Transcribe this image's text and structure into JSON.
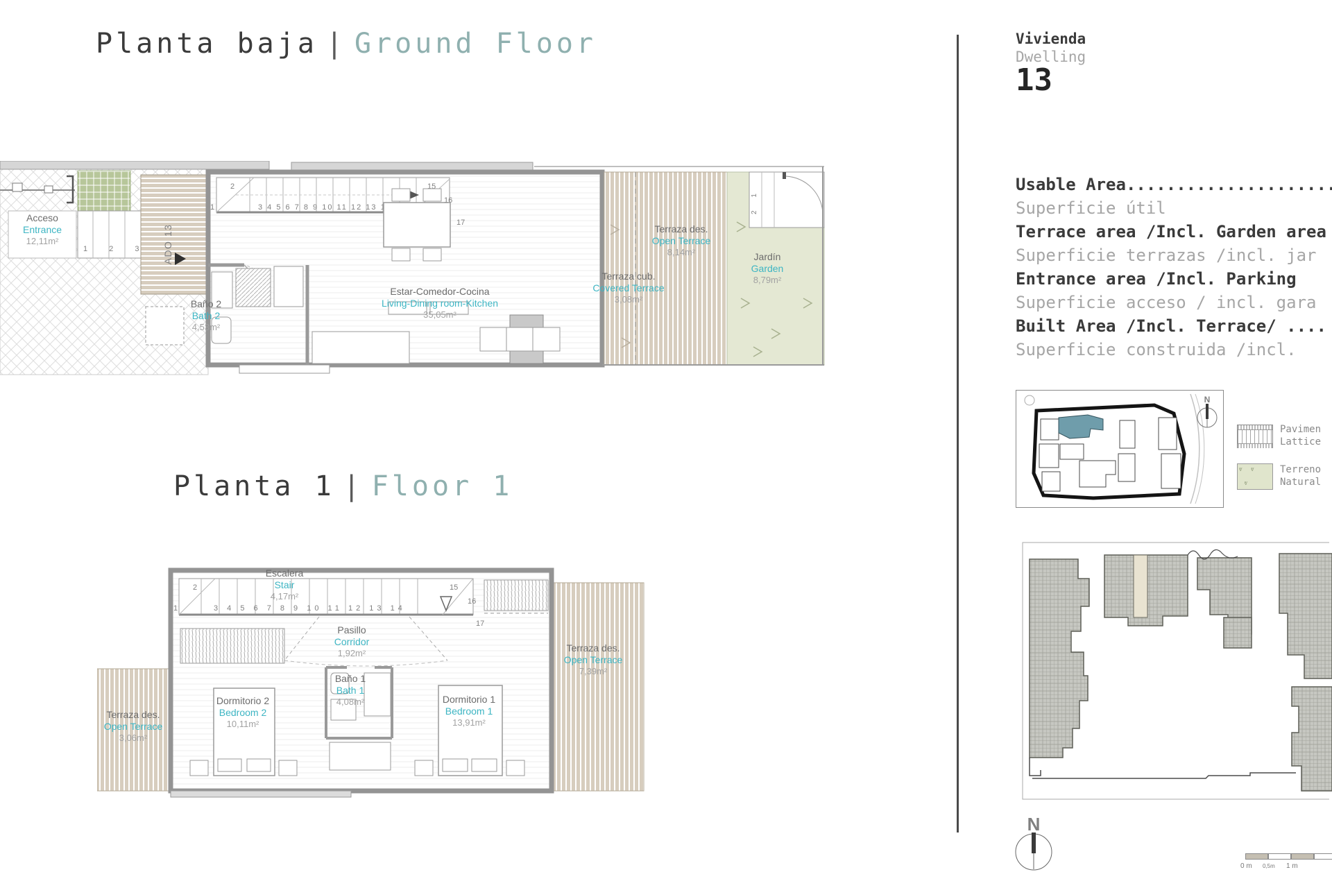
{
  "titles": {
    "ground": {
      "es": "Planta baja",
      "sep": "|",
      "en": "Ground Floor"
    },
    "floor1": {
      "es": "Planta 1",
      "sep": "|",
      "en": "Floor 1"
    }
  },
  "right_panel": {
    "dwelling": {
      "es": "Vivienda",
      "en": "Dwelling",
      "number": "13"
    },
    "rows": [
      {
        "en": "Usable Area.....................",
        "es": "Superficie útil"
      },
      {
        "en": "Terrace area /Incl. Garden area",
        "es": "Superficie terrazas /incl. jar"
      },
      {
        "en": "Entrance area /Incl. Parking",
        "es": "Superficie acceso / incl. gara"
      },
      {
        "en": "Built Area /Incl. Terrace/ ....",
        "es": "Superficie construida /incl. "
      }
    ]
  },
  "ground_floor": {
    "rooms": {
      "acceso": {
        "es": "Acceso",
        "en": "Entrance",
        "area": "12,11m²"
      },
      "bano2": {
        "es": "Baño 2",
        "en": "Bath 2",
        "area": "4,53m²"
      },
      "living": {
        "es": "Estar-Comedor-Cocina",
        "en": "Living-Dining room-Kitchen",
        "area": "35,05m²"
      },
      "terraza_des": {
        "es": "Terraza des.",
        "en": "Open Terrace",
        "area": "8,14m²"
      },
      "terraza_cub": {
        "es": "Terraza cub.",
        "en": "Covered Terrace",
        "area": "3,08m²"
      },
      "jardin": {
        "es": "Jardín",
        "en": "Garden",
        "area": "8,79m²"
      }
    },
    "ado_label": "ADO 13",
    "entry_steps": "1 2 3 4",
    "garden_steps": "2 1",
    "stairs": {
      "n1": "1",
      "n2": "2",
      "run": "3 4 5 6 7 8 9 10 11 12 13 14",
      "n15": "15",
      "n16": "16",
      "n17": "17"
    }
  },
  "floor1": {
    "rooms": {
      "escalera": {
        "es": "Escalera",
        "en": "Stair",
        "area": "4,17m²"
      },
      "pasillo": {
        "es": "Pasillo",
        "en": "Corridor",
        "area": "1,92m²"
      },
      "bano1": {
        "es": "Baño 1",
        "en": "Bath 1",
        "area": "4,08m²"
      },
      "dorm2": {
        "es": "Dormitorio 2",
        "en": "Bedroom 2",
        "area": "10,11m²"
      },
      "dorm1": {
        "es": "Dormitorio 1",
        "en": "Bedroom 1",
        "area": "13,91m²"
      },
      "terraza_left": {
        "es": "Terraza des.",
        "en": "Open Terrace",
        "area": "3,06m²"
      },
      "terraza_right": {
        "es": "Terraza des.",
        "en": "Open Terrace",
        "area": "7,39m²"
      }
    },
    "stairs": {
      "n1": "1",
      "n2": "2",
      "run": "3 4 5 6 7 8 9 10 11 12 13 14",
      "n15": "15",
      "n16": "16",
      "n17": "17"
    }
  },
  "legend": {
    "items": [
      {
        "line1": "Pavimen",
        "line2": "Lattice"
      },
      {
        "line1": "Terreno",
        "line2": "Natural"
      }
    ]
  },
  "scale_bar": {
    "labels": [
      "0 m",
      "0,5m",
      "1 m"
    ]
  },
  "compass": {
    "n": "N"
  },
  "minimap": {
    "n": "N"
  },
  "colors": {
    "accent_teal": "#3db5c3",
    "title_sage": "#8fb0af",
    "terrace_beige": "#d7cdbe",
    "garden_green": "#e4e8d3",
    "highlight_unit": "#6f9dab"
  }
}
